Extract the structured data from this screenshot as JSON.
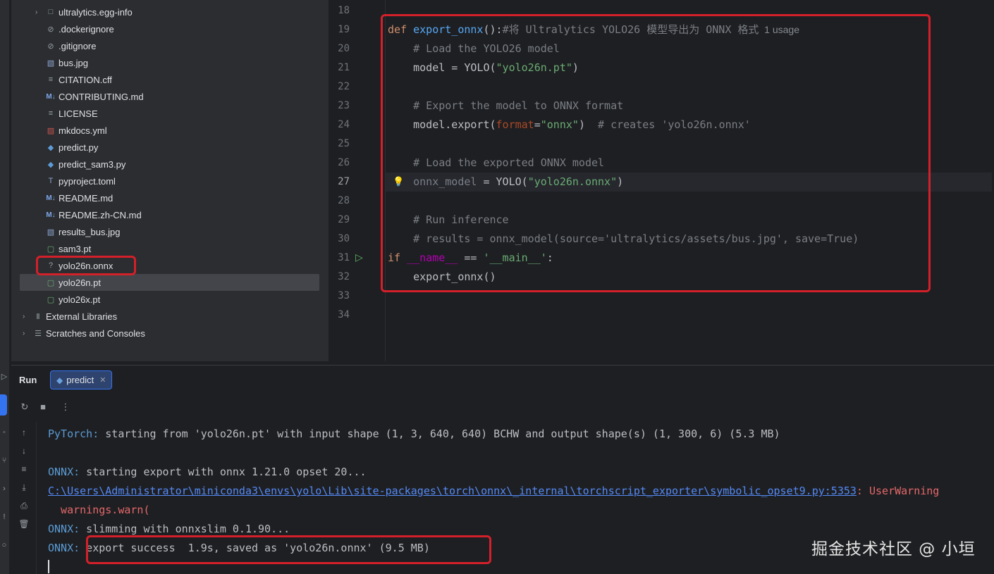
{
  "project_tree": {
    "items": [
      {
        "label": "ultralytics.egg-info",
        "icon": "folder-icon",
        "glyph": "□",
        "kind": "folder",
        "expander": true
      },
      {
        "label": ".dockerignore",
        "icon": "ignore-file-icon",
        "glyph": "⊘",
        "kind": "file"
      },
      {
        "label": ".gitignore",
        "icon": "ignore-file-icon",
        "glyph": "⊘",
        "kind": "file"
      },
      {
        "label": "bus.jpg",
        "icon": "image-file-icon",
        "glyph": "▧",
        "kind": "img"
      },
      {
        "label": "CITATION.cff",
        "icon": "text-file-icon",
        "glyph": "≡",
        "kind": "file"
      },
      {
        "label": "CONTRIBUTING.md",
        "icon": "markdown-file-icon",
        "glyph": "M↓",
        "kind": "md"
      },
      {
        "label": "LICENSE",
        "icon": "text-file-icon",
        "glyph": "≡",
        "kind": "file"
      },
      {
        "label": "mkdocs.yml",
        "icon": "yaml-file-icon",
        "glyph": "▨",
        "kind": "yml"
      },
      {
        "label": "predict.py",
        "icon": "python-file-icon",
        "glyph": "◆",
        "kind": "py"
      },
      {
        "label": "predict_sam3.py",
        "icon": "python-file-icon",
        "glyph": "◆",
        "kind": "py"
      },
      {
        "label": "pyproject.toml",
        "icon": "toml-file-icon",
        "glyph": "T",
        "kind": "img"
      },
      {
        "label": "README.md",
        "icon": "markdown-file-icon",
        "glyph": "M↓",
        "kind": "md"
      },
      {
        "label": "README.zh-CN.md",
        "icon": "markdown-file-icon",
        "glyph": "M↓",
        "kind": "md"
      },
      {
        "label": "results_bus.jpg",
        "icon": "image-file-icon",
        "glyph": "▧",
        "kind": "img"
      },
      {
        "label": "sam3.pt",
        "icon": "binary-file-icon",
        "glyph": "▢",
        "kind": "pt"
      },
      {
        "label": "yolo26n.onnx",
        "icon": "unknown-file-icon",
        "glyph": "?",
        "kind": "file"
      },
      {
        "label": "yolo26n.pt",
        "icon": "binary-file-icon",
        "glyph": "▢",
        "kind": "pt",
        "selected": true
      },
      {
        "label": "yolo26x.pt",
        "icon": "binary-file-icon",
        "glyph": "▢",
        "kind": "pt"
      },
      {
        "label": "External Libraries",
        "icon": "library-icon",
        "glyph": "Ⅱ",
        "kind": "folder",
        "expander": true
      },
      {
        "label": "Scratches and Consoles",
        "icon": "scratches-icon",
        "glyph": "☰",
        "kind": "folder",
        "expander": true
      }
    ]
  },
  "editor": {
    "line_numbers": [
      "18",
      "19",
      "20",
      "21",
      "22",
      "23",
      "24",
      "25",
      "26",
      "27",
      "28",
      "29",
      "30",
      "31",
      "32",
      "33",
      "34"
    ],
    "current_line": "27",
    "lines": [
      {
        "no": "18",
        "tokens": []
      },
      {
        "no": "19",
        "tokens": [
          {
            "t": "def ",
            "c": "kw"
          },
          {
            "t": "export_onnx",
            "c": "fn"
          },
          {
            "t": "():",
            "c": ""
          },
          {
            "t": "#将 Ultralytics YOLO26 模型导出为 ONNX 格式",
            "c": "cm"
          },
          {
            "t": "  1 usage",
            "c": "hint"
          }
        ]
      },
      {
        "no": "20",
        "tokens": [
          {
            "t": "    # Load the YOLO26 model",
            "c": "cm"
          }
        ]
      },
      {
        "no": "21",
        "tokens": [
          {
            "t": "    model = YOLO(",
            "c": ""
          },
          {
            "t": "\"yolo26n.pt\"",
            "c": "str"
          },
          {
            "t": ")",
            "c": ""
          }
        ]
      },
      {
        "no": "22",
        "tokens": []
      },
      {
        "no": "23",
        "tokens": [
          {
            "t": "    # Export the model to ONNX format",
            "c": "cm"
          }
        ]
      },
      {
        "no": "24",
        "tokens": [
          {
            "t": "    model.export(",
            "c": ""
          },
          {
            "t": "format",
            "c": "param"
          },
          {
            "t": "=",
            "c": ""
          },
          {
            "t": "\"onnx\"",
            "c": "str"
          },
          {
            "t": ")  ",
            "c": ""
          },
          {
            "t": "# creates 'yolo26n.onnx'",
            "c": "cm"
          }
        ]
      },
      {
        "no": "25",
        "tokens": []
      },
      {
        "no": "26",
        "tokens": [
          {
            "t": "    # Load the exported ONNX model",
            "c": "cm"
          }
        ]
      },
      {
        "no": "27",
        "tokens": [
          {
            "t": "    ",
            "c": ""
          },
          {
            "t": "onnx_model",
            "c": "cm"
          },
          {
            "t": " = YOLO(",
            "c": ""
          },
          {
            "t": "\"yolo26n.onnx\"",
            "c": "str"
          },
          {
            "t": ")",
            "c": ""
          }
        ]
      },
      {
        "no": "28",
        "tokens": []
      },
      {
        "no": "29",
        "tokens": [
          {
            "t": "    # Run inference",
            "c": "cm"
          }
        ]
      },
      {
        "no": "30",
        "tokens": [
          {
            "t": "    # results = onnx_model(source='ultralytics/assets/bus.jpg', save=True)",
            "c": "cm"
          }
        ]
      },
      {
        "no": "31",
        "tokens": [
          {
            "t": "if ",
            "c": "kw"
          },
          {
            "t": "__name__",
            "c": "mag"
          },
          {
            "t": " == ",
            "c": ""
          },
          {
            "t": "'__main__'",
            "c": "str"
          },
          {
            "t": ":",
            "c": ""
          }
        ]
      },
      {
        "no": "32",
        "tokens": [
          {
            "t": "    export_onnx()",
            "c": ""
          }
        ]
      },
      {
        "no": "33",
        "tokens": []
      },
      {
        "no": "34",
        "tokens": []
      }
    ]
  },
  "run_panel": {
    "title": "Run",
    "tab_label": "predict",
    "console_lines": [
      [
        {
          "t": "PyTorch:",
          "c": "tag"
        },
        {
          "t": " starting from 'yolo26n.pt' with input shape (1, 3, 640, 640) BCHW and output shape(s) (1, 300, 6) (5.3 MB)",
          "c": ""
        }
      ],
      [],
      [
        {
          "t": "ONNX:",
          "c": "tag"
        },
        {
          "t": " starting export with onnx 1.21.0 opset 20...",
          "c": ""
        }
      ],
      [
        {
          "t": "C:\\Users\\Administrator\\miniconda3\\envs\\yolo\\Lib\\site-packages\\torch\\onnx\\_internal\\torchscript_exporter\\symbolic_opset9.py:5353",
          "c": "link"
        },
        {
          "t": ": UserWarning",
          "c": "warn"
        }
      ],
      [
        {
          "t": "  warnings.warn(",
          "c": "warn"
        }
      ],
      [
        {
          "t": "ONNX:",
          "c": "tag"
        },
        {
          "t": " slimming with onnxslim 0.1.90...",
          "c": ""
        }
      ],
      [
        {
          "t": "ONNX:",
          "c": "tag"
        },
        {
          "t": " export success  1.9s, saved as 'yolo26n.onnx' (9.5 MB)",
          "c": ""
        }
      ]
    ]
  },
  "watermark": "掘金技术社区 @ 小垣"
}
